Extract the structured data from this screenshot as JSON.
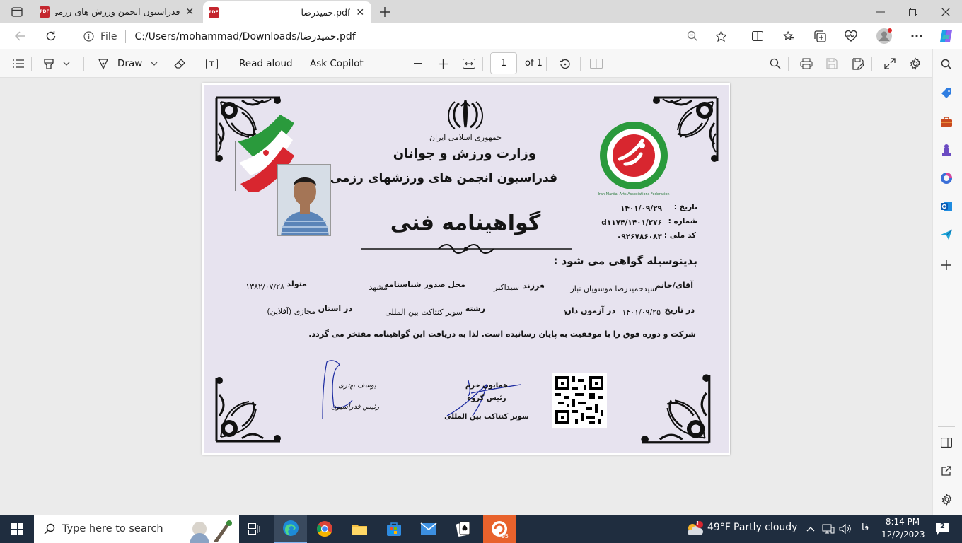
{
  "browser": {
    "tabs": [
      {
        "title": "فدراسیون انجمن ورزش های رزمی ا",
        "icon": "pdf-icon"
      },
      {
        "title": "حمیدرضا.pdf",
        "icon": "pdf-icon"
      }
    ],
    "address": {
      "scheme_label": "File",
      "url": "C:/Users/mohammad/Downloads/حمیدرضا.pdf"
    }
  },
  "pdf_toolbar": {
    "draw_label": "Draw",
    "read_aloud_label": "Read aloud",
    "ask_copilot_label": "Ask Copilot",
    "page_number": "1",
    "page_total": "of 1"
  },
  "certificate": {
    "republic": "جمهوری اسلامی ایران",
    "ministry": "وزارت ورزش و جوانان",
    "federation": "فدراسیون انجمن های ورزشهای رزمی",
    "title": "گواهینامه فنی",
    "date_label": "تاریخ :",
    "date_value": "۱۴۰۱/۰۹/۲۹",
    "number_label": "شماره :",
    "number_value": "۱۴۰۱/۲۷۶/d۱۱۷۴",
    "national_id_label": "کد ملی :",
    "national_id_value": "۰۹۲۶۷۸۶۰۸۳",
    "intro": "بدینوسیله گواهی می شود :",
    "line1": {
      "name_label": "آقای/خانم",
      "name_value": "سیدحمیدرضا موسویان تبار",
      "father_label": "فرزند",
      "father_value": "سیداکبر",
      "place_label": "محل صدور شناسنامه",
      "place_value": "مشهد",
      "born_label": "متولد",
      "born_value": "۱۳۸۲/۰۷/۲۸"
    },
    "line2": {
      "exam_date_label": "در تاریخ",
      "exam_date_value": "۱۴۰۱/۰۹/۲۵",
      "exam_label": "در آزمون دان",
      "exam_value": "۱",
      "field_label": "رشته",
      "field_value": "سوپر کنتاکت بین المللی",
      "province_label": "در استان",
      "province_value": "مجازی (آفلاین)"
    },
    "line3": "شرکت و دوره فوق را با موفقیت به پایان رسانیده است. لذا به دریافت این گواهینامه مفتخر می گردد.",
    "sig_left": {
      "name": "یوسف بهتری",
      "role": "رئیس فدراسیون"
    },
    "sig_mid": {
      "name": "همایون خرم",
      "role": "رئیس گروه",
      "group": "سوپر کنتاکت بین المللی"
    },
    "emblem_ring": "Iran Martial Arts Associations Federation"
  },
  "taskbar": {
    "search_placeholder": "Type here to search",
    "weather_temp": "49°F",
    "weather_text": "Partly cloudy",
    "weather_badge": "1",
    "lang": "فا",
    "time": "8:14 PM",
    "date": "12/2/2023",
    "notif_count": "2",
    "app_badge": "95"
  }
}
